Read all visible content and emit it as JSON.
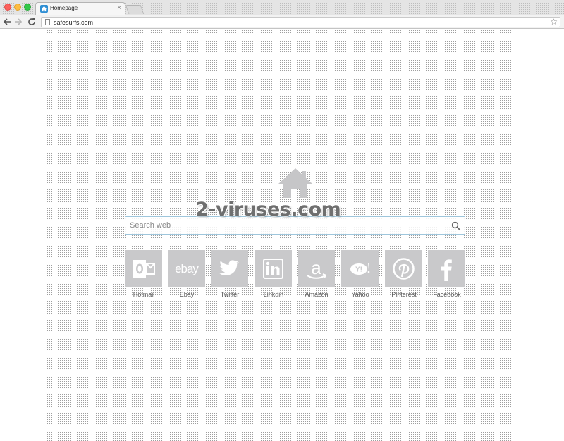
{
  "browser": {
    "tab": {
      "title": "Homepage",
      "close": "×"
    },
    "address_bar": {
      "url": "safesurfs.com"
    },
    "icons": [
      "back-icon",
      "forward-icon",
      "reload-icon",
      "page-icon",
      "bookmark-star-icon"
    ]
  },
  "page": {
    "search": {
      "placeholder": "Search web",
      "value": ""
    },
    "watermark": "2-viruses.com",
    "tiles": [
      {
        "label": "Hotmail",
        "icon": "outlook-icon"
      },
      {
        "label": "Ebay",
        "icon": "ebay-icon"
      },
      {
        "label": "Twitter",
        "icon": "twitter-icon"
      },
      {
        "label": "Linkdin",
        "icon": "linkedin-icon"
      },
      {
        "label": "Amazon",
        "icon": "amazon-icon"
      },
      {
        "label": "Yahoo",
        "icon": "yahoo-icon"
      },
      {
        "label": "Pinterest",
        "icon": "pinterest-icon"
      },
      {
        "label": "Facebook",
        "icon": "facebook-icon"
      }
    ]
  },
  "colors": {
    "tile": "#c9c9cb",
    "tile_glyph": "#ffffff",
    "search_border": "#9ec6dc",
    "home_icon": "#c6c6c8"
  }
}
